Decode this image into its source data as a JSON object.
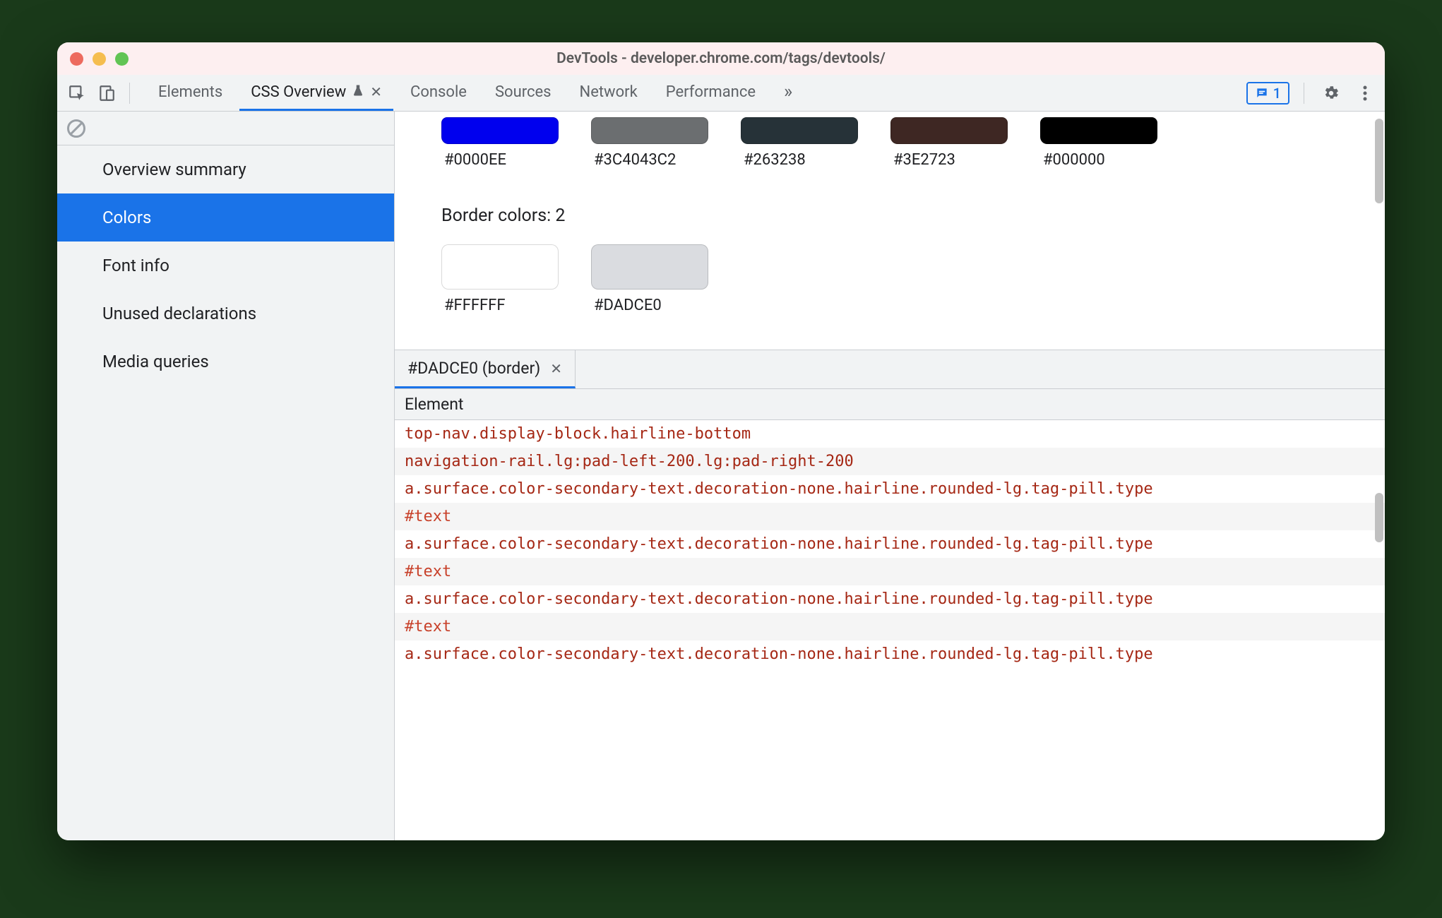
{
  "window_title": "DevTools - developer.chrome.com/tags/devtools/",
  "toolbar": {
    "tabs": [
      {
        "label": "Elements",
        "active": false
      },
      {
        "label": "CSS Overview",
        "active": true,
        "experimental": true,
        "closable": true
      },
      {
        "label": "Console",
        "active": false
      },
      {
        "label": "Sources",
        "active": false
      },
      {
        "label": "Network",
        "active": false
      },
      {
        "label": "Performance",
        "active": false
      }
    ],
    "overflow_glyph": "»",
    "issues_count": "1"
  },
  "sidebar": {
    "items": [
      {
        "label": "Overview summary",
        "active": false
      },
      {
        "label": "Colors",
        "active": true
      },
      {
        "label": "Font info",
        "active": false
      },
      {
        "label": "Unused declarations",
        "active": false
      },
      {
        "label": "Media queries",
        "active": false
      }
    ]
  },
  "colors": {
    "top_row": [
      {
        "hex": "#0000EE",
        "fill": "#0000EE"
      },
      {
        "hex": "#3C4043C2",
        "fill": "rgba(60,64,67,0.76)"
      },
      {
        "hex": "#263238",
        "fill": "#263238"
      },
      {
        "hex": "#3E2723",
        "fill": "#3E2723"
      },
      {
        "hex": "#000000",
        "fill": "#000000"
      }
    ],
    "border_title": "Border colors: 2",
    "border_row": [
      {
        "hex": "#FFFFFF",
        "fill": "#FFFFFF"
      },
      {
        "hex": "#DADCE0",
        "fill": "#DADCE0"
      }
    ]
  },
  "detail": {
    "tab_label": "#DADCE0 (border)",
    "column_header": "Element",
    "rows": [
      "top-nav.display-block.hairline-bottom",
      "navigation-rail.lg:pad-left-200.lg:pad-right-200",
      "a.surface.color-secondary-text.decoration-none.hairline.rounded-lg.tag-pill.type",
      "#text",
      "a.surface.color-secondary-text.decoration-none.hairline.rounded-lg.tag-pill.type",
      "#text",
      "a.surface.color-secondary-text.decoration-none.hairline.rounded-lg.tag-pill.type",
      "#text",
      "a.surface.color-secondary-text.decoration-none.hairline.rounded-lg.tag-pill.type"
    ]
  }
}
